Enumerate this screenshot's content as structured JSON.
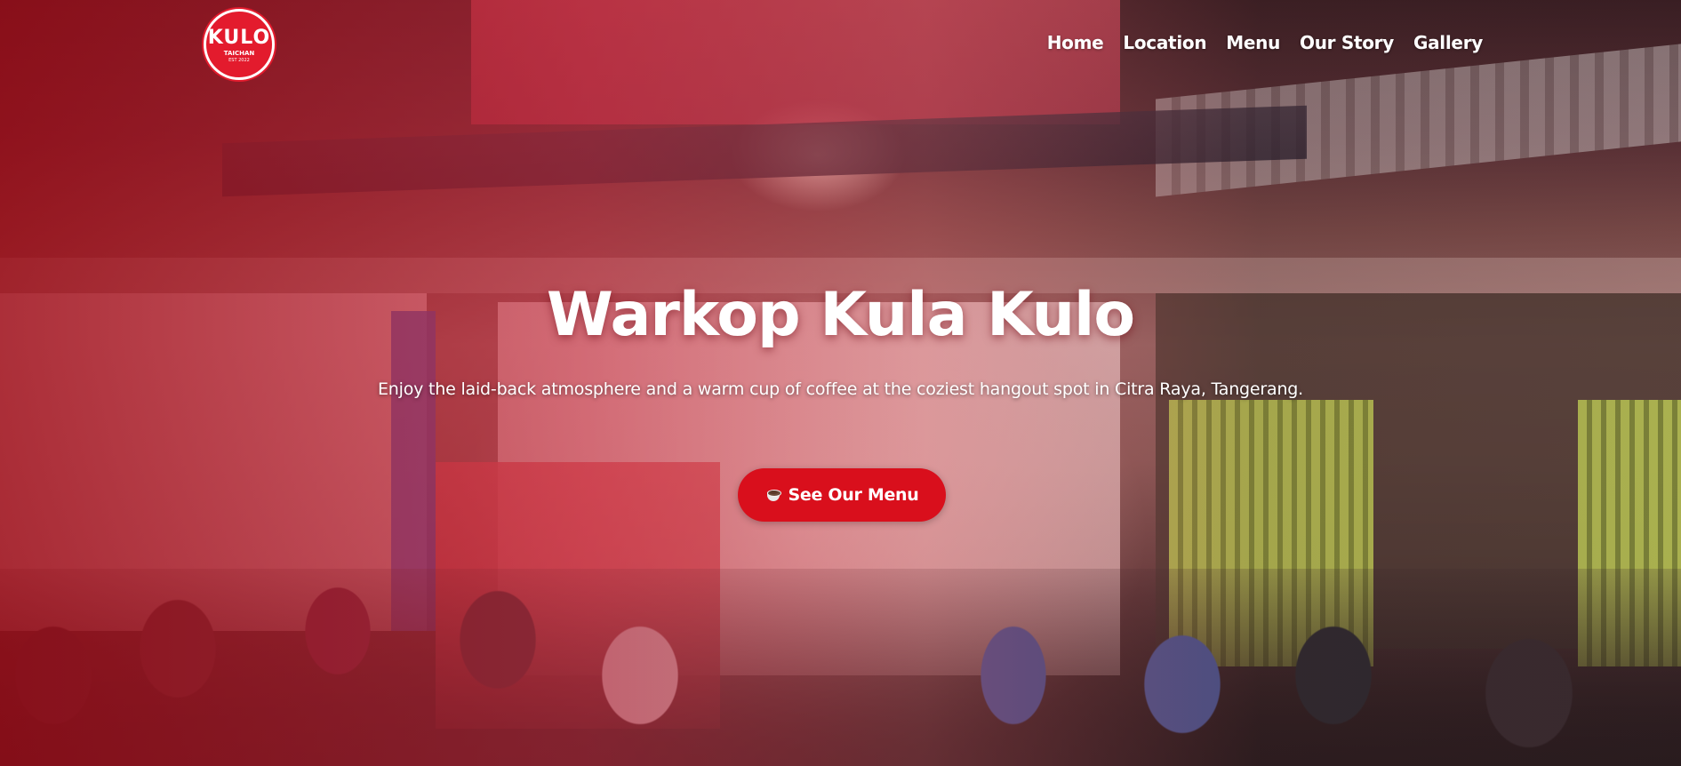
{
  "header": {
    "logo": {
      "main_text": "KULO",
      "sub_text": "TAICHAN",
      "small_text": "EST 2022"
    },
    "nav": [
      {
        "label": "Home"
      },
      {
        "label": "Location"
      },
      {
        "label": "Menu"
      },
      {
        "label": "Our Story"
      },
      {
        "label": "Gallery"
      }
    ]
  },
  "hero": {
    "title": "Warkop Kula Kulo",
    "subtitle": "Enjoy the laid-back atmosphere and a warm cup of coffee at the coziest hangout spot in Citra Raya, Tangerang.",
    "cta": {
      "label": "See Our Menu",
      "icon": "coffee-cup-icon"
    },
    "background_description_color": "#c81e2e"
  },
  "colors": {
    "brand_red": "#d90f1c",
    "text": "#ffffff"
  }
}
